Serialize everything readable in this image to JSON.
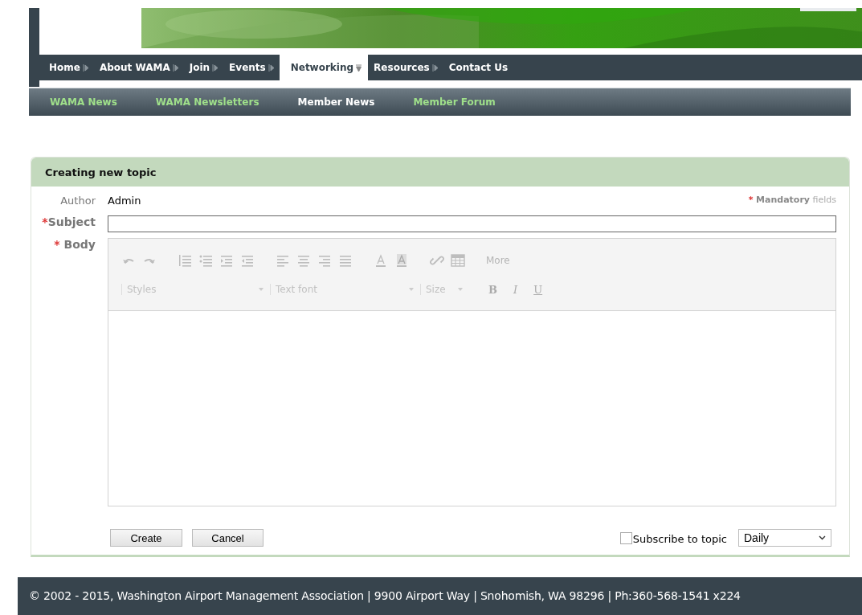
{
  "nav": [
    {
      "label": "Home",
      "submenu": true,
      "selected": false
    },
    {
      "label": "About WAMA",
      "submenu": true,
      "selected": false
    },
    {
      "label": "Join",
      "submenu": true,
      "selected": false
    },
    {
      "label": "Events",
      "submenu": true,
      "selected": false
    },
    {
      "label": "Networking",
      "submenu": true,
      "selected": true
    },
    {
      "label": "Resources",
      "submenu": true,
      "selected": false
    },
    {
      "label": "Contact Us",
      "submenu": false,
      "selected": false
    }
  ],
  "subnav": [
    {
      "label": "WAMA News",
      "selected": false
    },
    {
      "label": "WAMA Newsletters",
      "selected": false
    },
    {
      "label": "Member News",
      "selected": true
    },
    {
      "label": "Member Forum",
      "selected": false
    }
  ],
  "form": {
    "title": "Creating new topic",
    "mandatory_note": {
      "mark": "*",
      "text": "**Mandatory** fields"
    },
    "author": {
      "label": "Author",
      "value": "Admin"
    },
    "subject": {
      "mark": "*",
      "label": "Subject"
    },
    "body": {
      "mark": "*",
      "label": "Body",
      "toolbar": {
        "more": "More",
        "styles": "Styles",
        "font": "Text font",
        "size": "Size",
        "bold": "B",
        "italic": "I",
        "underline": "U"
      }
    },
    "buttons": [
      "Create",
      "Cancel"
    ],
    "subscribe": {
      "label": "Subscribe to topic",
      "checked": false
    },
    "frequency": "Daily"
  },
  "footer": "© 2002 - 2015, Washington Airport Management Association | 9900 Airport Way | Snohomish, WA 98296 | Ph:360-568-1541 x224"
}
